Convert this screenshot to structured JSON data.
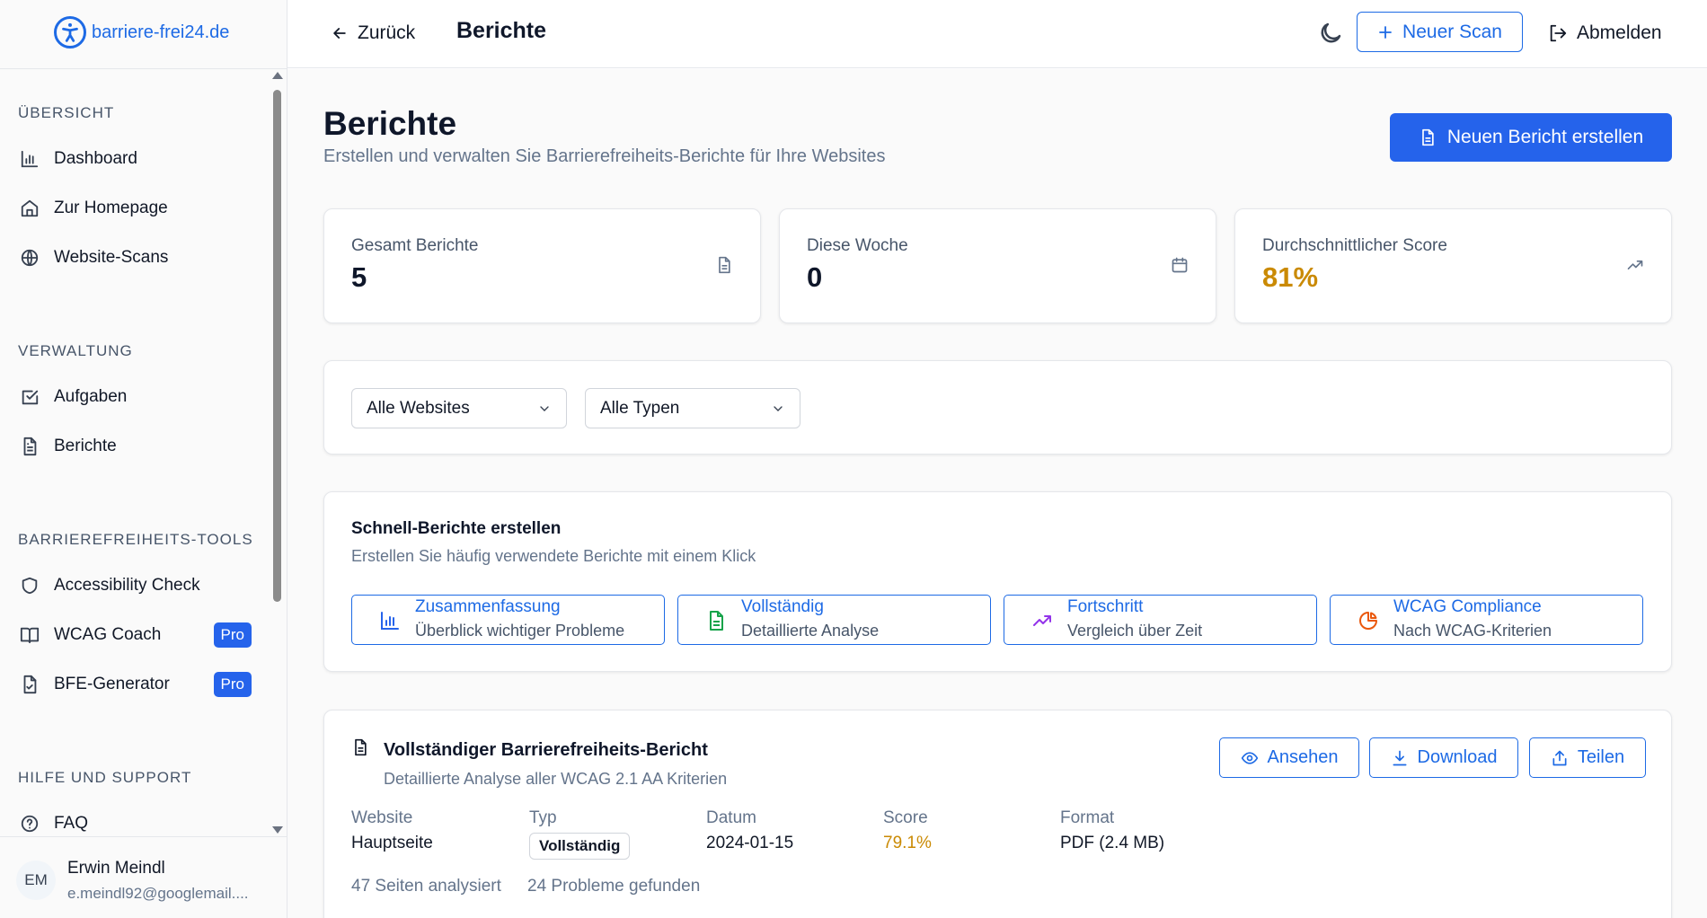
{
  "brand": {
    "logo_text": "barriere-frei24.de",
    "accent": "#1d6ae5",
    "primary": "#2563eb"
  },
  "sidebar": {
    "sections": [
      {
        "title": "ÜBERSICHT",
        "items": [
          {
            "label": "Dashboard",
            "icon": "bar-chart-icon"
          },
          {
            "label": "Zur Homepage",
            "icon": "home-icon"
          },
          {
            "label": "Website-Scans",
            "icon": "globe-icon"
          }
        ]
      },
      {
        "title": "VERWALTUNG",
        "items": [
          {
            "label": "Aufgaben",
            "icon": "checkbox-icon"
          },
          {
            "label": "Berichte",
            "icon": "file-text-icon"
          }
        ]
      },
      {
        "title": "BARRIEREFREIHEITS-TOOLS",
        "items": [
          {
            "label": "Accessibility Check",
            "icon": "shield-icon"
          },
          {
            "label": "WCAG Coach",
            "icon": "book-icon",
            "badge": "Pro"
          },
          {
            "label": "BFE-Generator",
            "icon": "file-check-icon",
            "badge": "Pro"
          }
        ]
      },
      {
        "title": "HILFE UND SUPPORT",
        "items": [
          {
            "label": "FAQ",
            "icon": "help-circle-icon"
          }
        ]
      }
    ],
    "user": {
      "initials": "EM",
      "name": "Erwin Meindl",
      "email": "e.meindl92@googlemail...."
    }
  },
  "topbar": {
    "back_label": "Zurück",
    "title": "Berichte",
    "new_scan_label": "Neuer Scan",
    "logout_label": "Abmelden"
  },
  "page": {
    "title": "Berichte",
    "subtitle": "Erstellen und verwalten Sie Barrierefreiheits-Berichte für Ihre Websites",
    "create_button": "Neuen Bericht erstellen"
  },
  "stats": [
    {
      "label": "Gesamt Berichte",
      "value": "5",
      "icon": "file-text-icon"
    },
    {
      "label": "Diese Woche",
      "value": "0",
      "icon": "calendar-icon"
    },
    {
      "label": "Durchschnittlicher Score",
      "value": "81%",
      "icon": "trending-up-icon",
      "value_color": "#ca8a04"
    }
  ],
  "filters": {
    "website": {
      "selected": "Alle Websites"
    },
    "type": {
      "selected": "Alle Typen"
    }
  },
  "quick_reports": {
    "title": "Schnell-Berichte erstellen",
    "subtitle": "Erstellen Sie häufig verwendete Berichte mit einem Klick",
    "items": [
      {
        "title": "Zusammenfassung",
        "subtitle": "Überblick wichtiger Probleme",
        "icon": "bar-chart-icon",
        "icon_color": "#2563eb"
      },
      {
        "title": "Vollständig",
        "subtitle": "Detaillierte Analyse",
        "icon": "file-text-icon",
        "icon_color": "#16a34a"
      },
      {
        "title": "Fortschritt",
        "subtitle": "Vergleich über Zeit",
        "icon": "trending-up-icon",
        "icon_color": "#9333ea"
      },
      {
        "title": "WCAG Compliance",
        "subtitle": "Nach WCAG-Kriterien",
        "icon": "pie-chart-icon",
        "icon_color": "#ea580c"
      }
    ]
  },
  "report": {
    "title": "Vollständiger Barrierefreiheits-Bericht",
    "description": "Detaillierte Analyse aller WCAG 2.1 AA Kriterien",
    "actions": {
      "view": "Ansehen",
      "download": "Download",
      "share": "Teilen"
    },
    "meta": {
      "website_label": "Website",
      "website_value": "Hauptseite",
      "type_label": "Typ",
      "type_value": "Vollständig",
      "date_label": "Datum",
      "date_value": "2024-01-15",
      "score_label": "Score",
      "score_value": "79.1%",
      "score_color": "#ca8a04",
      "format_label": "Format",
      "format_value": "PDF (2.4 MB)"
    },
    "pages_analyzed": "47 Seiten analysiert",
    "problems_found": "24 Probleme gefunden"
  }
}
